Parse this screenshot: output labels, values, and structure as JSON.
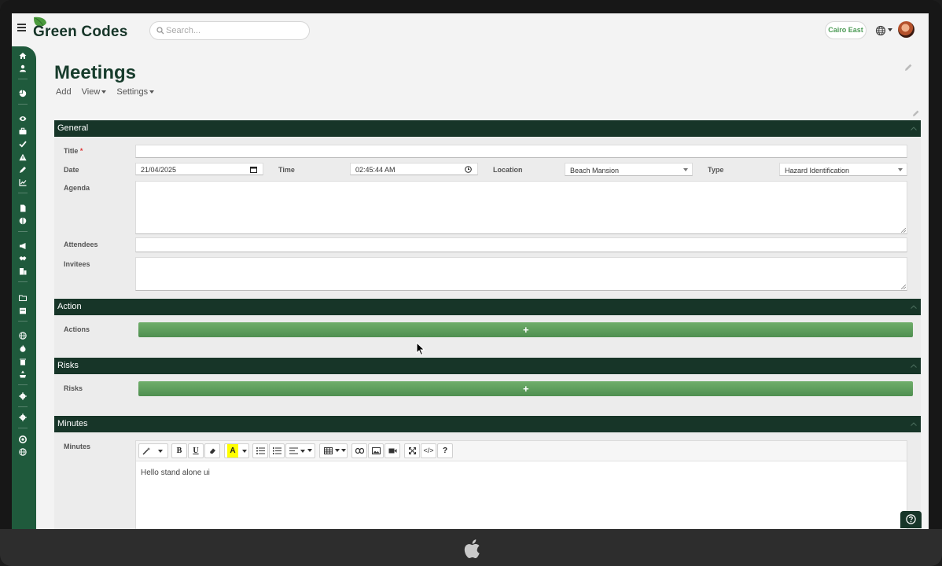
{
  "app": {
    "brand": "Green Codes",
    "search_placeholder": "Search...",
    "location_pill": "Cairo East"
  },
  "page": {
    "title": "Meetings",
    "menu": {
      "add": "Add",
      "view": "View",
      "settings": "Settings"
    }
  },
  "sections": {
    "general": {
      "title": "General",
      "labels": {
        "title": "Title",
        "required_mark": "*",
        "date": "Date",
        "time": "Time",
        "location": "Location",
        "type": "Type",
        "agenda": "Agenda",
        "attendees": "Attendees",
        "invitees": "Invitees"
      },
      "values": {
        "title": "",
        "date": "21/04/2025",
        "time": "02:45:44 AM",
        "location": "Beach Mansion",
        "type": "Hazard Identification"
      }
    },
    "action": {
      "title": "Action",
      "label": "Actions",
      "add_symbol": "+"
    },
    "risks": {
      "title": "Risks",
      "label": "Risks",
      "add_symbol": "+"
    },
    "minutes": {
      "title": "Minutes",
      "label": "Minutes",
      "content": "Hello stand alone ui",
      "toolbar": {
        "bold": "B",
        "underline": "U",
        "font_color": "A",
        "code": "</>",
        "help": "?"
      }
    }
  },
  "colors": {
    "header_dark": "#173528",
    "sidebar": "#1f5a3c",
    "add_bar": "#5f9f5e",
    "location_text": "#4d9b56"
  },
  "icons": {
    "sidebar": [
      "home-icon",
      "user-icon",
      "chart-pie-icon",
      "eye-icon",
      "briefcase-icon",
      "check-icon",
      "warning-icon",
      "pen-icon",
      "line-chart-icon",
      "document-icon",
      "globe-half-icon",
      "megaphone-icon",
      "handshake-icon",
      "building-icon",
      "folder-icon",
      "calendar-icon",
      "globe-icon",
      "flame-icon",
      "trash-icon",
      "recycle-icon",
      "gear-icon",
      "settings-icon",
      "support-icon",
      "language-icon"
    ]
  }
}
